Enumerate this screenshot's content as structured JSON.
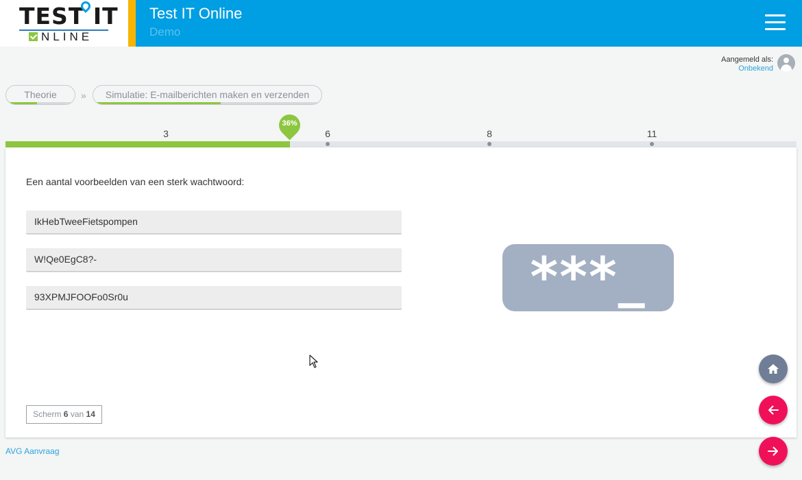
{
  "header": {
    "logo_main": "TEST IT",
    "logo_sub": "NLINE",
    "title": "Test IT Online",
    "subtitle": "Demo"
  },
  "user": {
    "label": "Aangemeld als:",
    "name": "Onbekend"
  },
  "breadcrumbs": {
    "items": [
      {
        "label": "Theorie",
        "progress": 0.45
      },
      {
        "label": "Simulatie: E-mailberichten maken en verzenden",
        "progress": 0.56
      }
    ],
    "separator": "»"
  },
  "timeline": {
    "progress_percent": 36,
    "progress_label": "36%",
    "markers": [
      "3",
      "6",
      "8",
      "11"
    ]
  },
  "content": {
    "intro": "Een aantal voorbeelden van een sterk wachtwoord:",
    "passwords": [
      "IkHebTweeFietspompen",
      "W!Qe0EgC8?-",
      "93XPMJFOOFo0Sr0u"
    ],
    "graphic_text": "***_"
  },
  "screen_counter": {
    "prefix": "Scherm",
    "current": "6",
    "middle": "van",
    "total": "14"
  },
  "footer": {
    "avg_link": "AVG Aanvraag"
  },
  "colors": {
    "header_blue": "#009ee3",
    "accent_yellow": "#f7b500",
    "progress_green": "#8dc63f",
    "fab_pink": "#f0105a",
    "fab_home": "#6f7d96"
  }
}
